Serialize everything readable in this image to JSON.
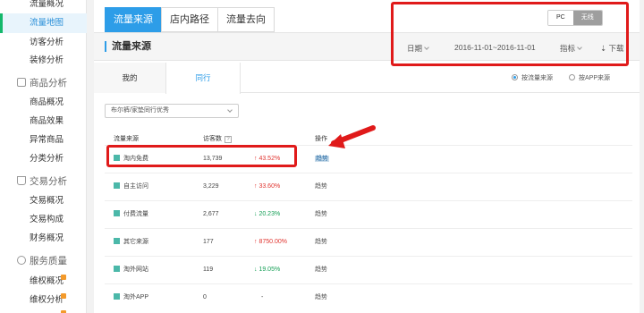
{
  "sidebar": {
    "items": [
      {
        "label": "流量概况"
      },
      {
        "label": "流量地图"
      },
      {
        "label": "访客分析"
      },
      {
        "label": "装修分析"
      }
    ],
    "groups": [
      {
        "label": "商品分析",
        "icon": "bag-icon",
        "items": [
          {
            "label": "商品概况"
          },
          {
            "label": "商品效果"
          },
          {
            "label": "异常商品"
          },
          {
            "label": "分类分析"
          }
        ]
      },
      {
        "label": "交易分析",
        "icon": "cart-icon",
        "items": [
          {
            "label": "交易概况"
          },
          {
            "label": "交易构成"
          },
          {
            "label": "财务概况"
          }
        ]
      },
      {
        "label": "服务质量",
        "icon": "headset-icon",
        "items": [
          {
            "label": "维权概况"
          },
          {
            "label": "维权分析"
          }
        ]
      }
    ]
  },
  "main": {
    "tabs": [
      {
        "label": "流量来源"
      },
      {
        "label": "店内路径"
      },
      {
        "label": "流量去向"
      }
    ],
    "device_toggle": {
      "pc": "PC",
      "wireless": "无线"
    },
    "section_title": "流量来源",
    "date_label": "日期",
    "date_range": "2016-11-01~2016-11-01",
    "metric_label": "指标",
    "download_label": "下载",
    "subtabs": {
      "mine": "我的",
      "peer": "同行"
    },
    "radio": {
      "by_source": "按流量来源",
      "by_app": "按APP来源"
    },
    "select_value": "布尔裤/家垫同行优秀",
    "table": {
      "headers": {
        "source": "流量来源",
        "visitors": "访客数",
        "help": "?",
        "action": "操作"
      },
      "rows": [
        {
          "source": "淘内免费",
          "visitors": "13,739",
          "change": "43.52%",
          "dir": "up",
          "arrow": "↑",
          "action": "趋势"
        },
        {
          "source": "自主访问",
          "visitors": "3,229",
          "change": "33.60%",
          "dir": "up",
          "arrow": "↑",
          "action": "趋势"
        },
        {
          "source": "付费流量",
          "visitors": "2,677",
          "change": "20.23%",
          "dir": "down",
          "arrow": "↓",
          "action": "趋势"
        },
        {
          "source": "其它来源",
          "visitors": "177",
          "change": "8750.00%",
          "dir": "up",
          "arrow": "↑",
          "action": "趋势"
        },
        {
          "source": "淘外网站",
          "visitors": "119",
          "change": "19.05%",
          "dir": "down",
          "arrow": "↓",
          "action": "趋势"
        },
        {
          "source": "淘外APP",
          "visitors": "0",
          "change": "-",
          "dir": "none",
          "arrow": "",
          "action": "趋势"
        }
      ]
    }
  },
  "colors": {
    "accent": "#2d9de8",
    "highlight_red": "#e01a1a",
    "active_nav": "#14b86b",
    "up": "#e0342f",
    "down": "#18a058"
  }
}
